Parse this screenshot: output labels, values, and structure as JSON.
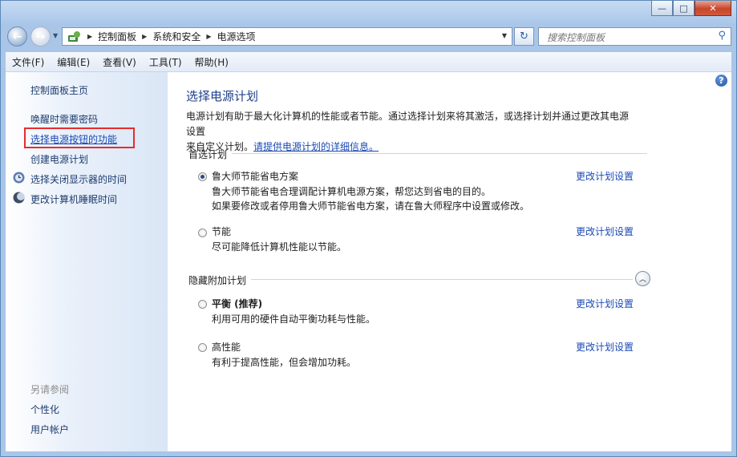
{
  "window": {
    "caption_buttons": {
      "minimize": "—",
      "maximize": "□",
      "close": "✕"
    }
  },
  "navbar": {
    "back_glyph": "←",
    "forward_glyph": "→",
    "breadcrumbs": [
      "控制面板",
      "系统和安全",
      "电源选项"
    ],
    "refresh_glyph": "↻",
    "search_placeholder": "搜索控制面板",
    "search_glyph": "⚲"
  },
  "menubar": {
    "items": [
      "文件(F)",
      "编辑(E)",
      "查看(V)",
      "工具(T)",
      "帮助(H)"
    ]
  },
  "sidebar": {
    "home": "控制面板主页",
    "links": [
      "唤醒时需要密码",
      "选择电源按钮的功能",
      "创建电源计划",
      "选择关闭显示器的时间",
      "更改计算机睡眠时间"
    ],
    "see_also_title": "另请参阅",
    "see_also": [
      "个性化",
      "用户帐户"
    ]
  },
  "main": {
    "help_glyph": "?",
    "title": "选择电源计划",
    "description_line1": "电源计划有助于最大化计算机的性能或者节能。通过选择计划来将其激活，或选择计划并通过更改其电源设置",
    "description_line2": "来自定义计划。",
    "description_link": "请提供电源计划的详细信息。",
    "preferred_group": "首选计划",
    "hidden_group": "隐藏附加计划",
    "collapse_glyph": "︿",
    "change_label": "更改计划设置",
    "plans": [
      {
        "name": "鲁大师节能省电方案",
        "selected": true,
        "desc1": "鲁大师节能省电合理调配计算机电源方案，帮您达到省电的目的。",
        "desc2": "如果要修改或者停用鲁大师节能省电方案，请在鲁大师程序中设置或修改。"
      },
      {
        "name": "节能",
        "selected": false,
        "desc1": "尽可能降低计算机性能以节能。"
      },
      {
        "name": "平衡 (推荐)",
        "selected": false,
        "desc1": "利用可用的硬件自动平衡功耗与性能。"
      },
      {
        "name": "高性能",
        "selected": false,
        "desc1": "有利于提高性能，但会增加功耗。"
      }
    ]
  }
}
